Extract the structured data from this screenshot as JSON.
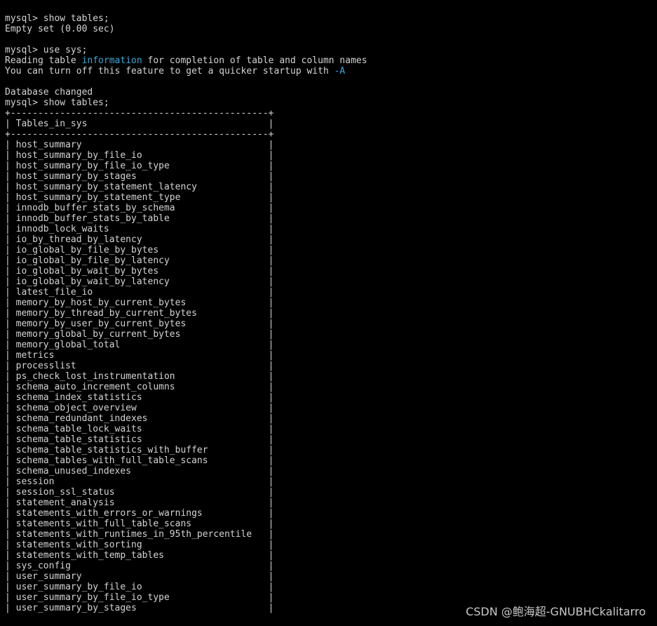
{
  "terminal": {
    "lines": [
      "mysql> show tables;",
      "Empty set (0.00 sec)",
      "",
      "mysql> use sys;",
      [
        "Reading table ",
        "information",
        " for completion of table and column names"
      ],
      [
        "You can turn off this feature to get a quicker startup with ",
        "-A",
        ""
      ],
      "",
      "Database changed",
      "mysql> show tables;",
      "+-----------------------------------------------+",
      "| Tables_in_sys                                 |",
      "+-----------------------------------------------+",
      "| host_summary                                  |",
      "| host_summary_by_file_io                       |",
      "| host_summary_by_file_io_type                  |",
      "| host_summary_by_stages                        |",
      "| host_summary_by_statement_latency             |",
      "| host_summary_by_statement_type                |",
      "| innodb_buffer_stats_by_schema                 |",
      "| innodb_buffer_stats_by_table                  |",
      "| innodb_lock_waits                             |",
      "| io_by_thread_by_latency                       |",
      "| io_global_by_file_by_bytes                    |",
      "| io_global_by_file_by_latency                  |",
      "| io_global_by_wait_by_bytes                    |",
      "| io_global_by_wait_by_latency                  |",
      "| latest_file_io                                |",
      "| memory_by_host_by_current_bytes               |",
      "| memory_by_thread_by_current_bytes             |",
      "| memory_by_user_by_current_bytes               |",
      "| memory_global_by_current_bytes                |",
      "| memory_global_total                           |",
      "| metrics                                       |",
      "| processlist                                   |",
      "| ps_check_lost_instrumentation                 |",
      "| schema_auto_increment_columns                 |",
      "| schema_index_statistics                       |",
      "| schema_object_overview                        |",
      "| schema_redundant_indexes                      |",
      "| schema_table_lock_waits                       |",
      "| schema_table_statistics                       |",
      "| schema_table_statistics_with_buffer           |",
      "| schema_tables_with_full_table_scans           |",
      "| schema_unused_indexes                         |",
      "| session                                       |",
      "| session_ssl_status                            |",
      "| statement_analysis                            |",
      "| statements_with_errors_or_warnings            |",
      "| statements_with_full_table_scans              |",
      "| statements_with_runtimes_in_95th_percentile   |",
      "| statements_with_sorting                       |",
      "| statements_with_temp_tables                   |",
      "| sys_config                                    |",
      "| user_summary                                  |",
      "| user_summary_by_file_io                       |",
      "| user_summary_by_file_io_type                  |",
      "| user_summary_by_stages                        |"
    ]
  },
  "watermark": "CSDN @鲍海超-GNUBHCkalitarro",
  "colors": {
    "background": "#000000",
    "text": "#d4d4d4",
    "highlight": "#3aa8d8",
    "watermark": "#c8c8c8"
  }
}
